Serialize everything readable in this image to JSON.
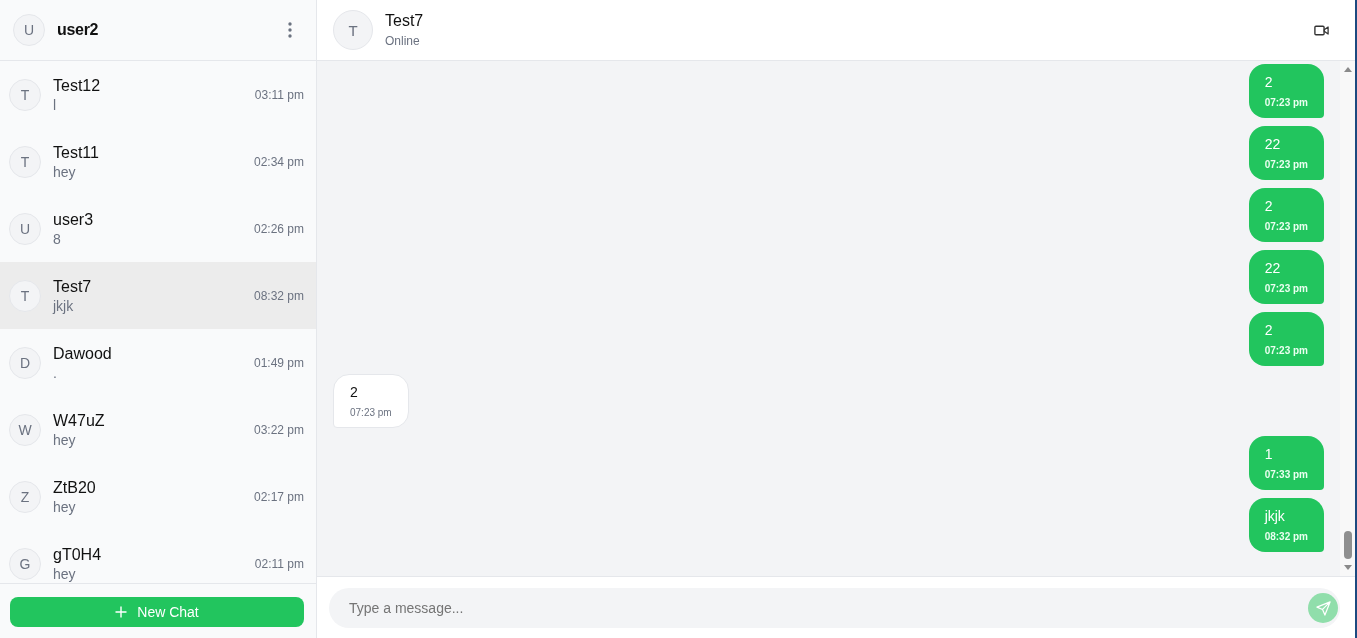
{
  "current_user": {
    "initial": "U",
    "name": "user2"
  },
  "chats": [
    {
      "initial": "T",
      "name": "Test12",
      "preview": "l",
      "time": "03:11 pm",
      "selected": false
    },
    {
      "initial": "T",
      "name": "Test11",
      "preview": "hey",
      "time": "02:34 pm",
      "selected": false
    },
    {
      "initial": "U",
      "name": "user3",
      "preview": "8",
      "time": "02:26 pm",
      "selected": false
    },
    {
      "initial": "T",
      "name": "Test7",
      "preview": "jkjk",
      "time": "08:32 pm",
      "selected": true
    },
    {
      "initial": "D",
      "name": "Dawood",
      "preview": ".",
      "time": "01:49 pm",
      "selected": false
    },
    {
      "initial": "W",
      "name": "W47uZ",
      "preview": "hey",
      "time": "03:22 pm",
      "selected": false
    },
    {
      "initial": "Z",
      "name": "ZtB20",
      "preview": "hey",
      "time": "02:17 pm",
      "selected": false
    },
    {
      "initial": "G",
      "name": "gT0H4",
      "preview": "hey",
      "time": "02:11 pm",
      "selected": false
    }
  ],
  "new_chat_button": {
    "label": "New Chat"
  },
  "conversation": {
    "initial": "T",
    "name": "Test7",
    "status": "Online"
  },
  "messages": [
    {
      "kind": "sent",
      "text": "2",
      "time": "07:23 pm"
    },
    {
      "kind": "sent",
      "text": "22",
      "time": "07:23 pm"
    },
    {
      "kind": "sent",
      "text": "2",
      "time": "07:23 pm"
    },
    {
      "kind": "sent",
      "text": "22",
      "time": "07:23 pm"
    },
    {
      "kind": "sent",
      "text": "2",
      "time": "07:23 pm"
    },
    {
      "kind": "received",
      "text": "2",
      "time": "07:23 pm"
    },
    {
      "kind": "sent",
      "text": "1",
      "time": "07:33 pm"
    },
    {
      "kind": "sent",
      "text": "jkjk",
      "time": "08:32 pm"
    }
  ],
  "composer": {
    "placeholder": "Type a message...",
    "send_disabled": true
  }
}
